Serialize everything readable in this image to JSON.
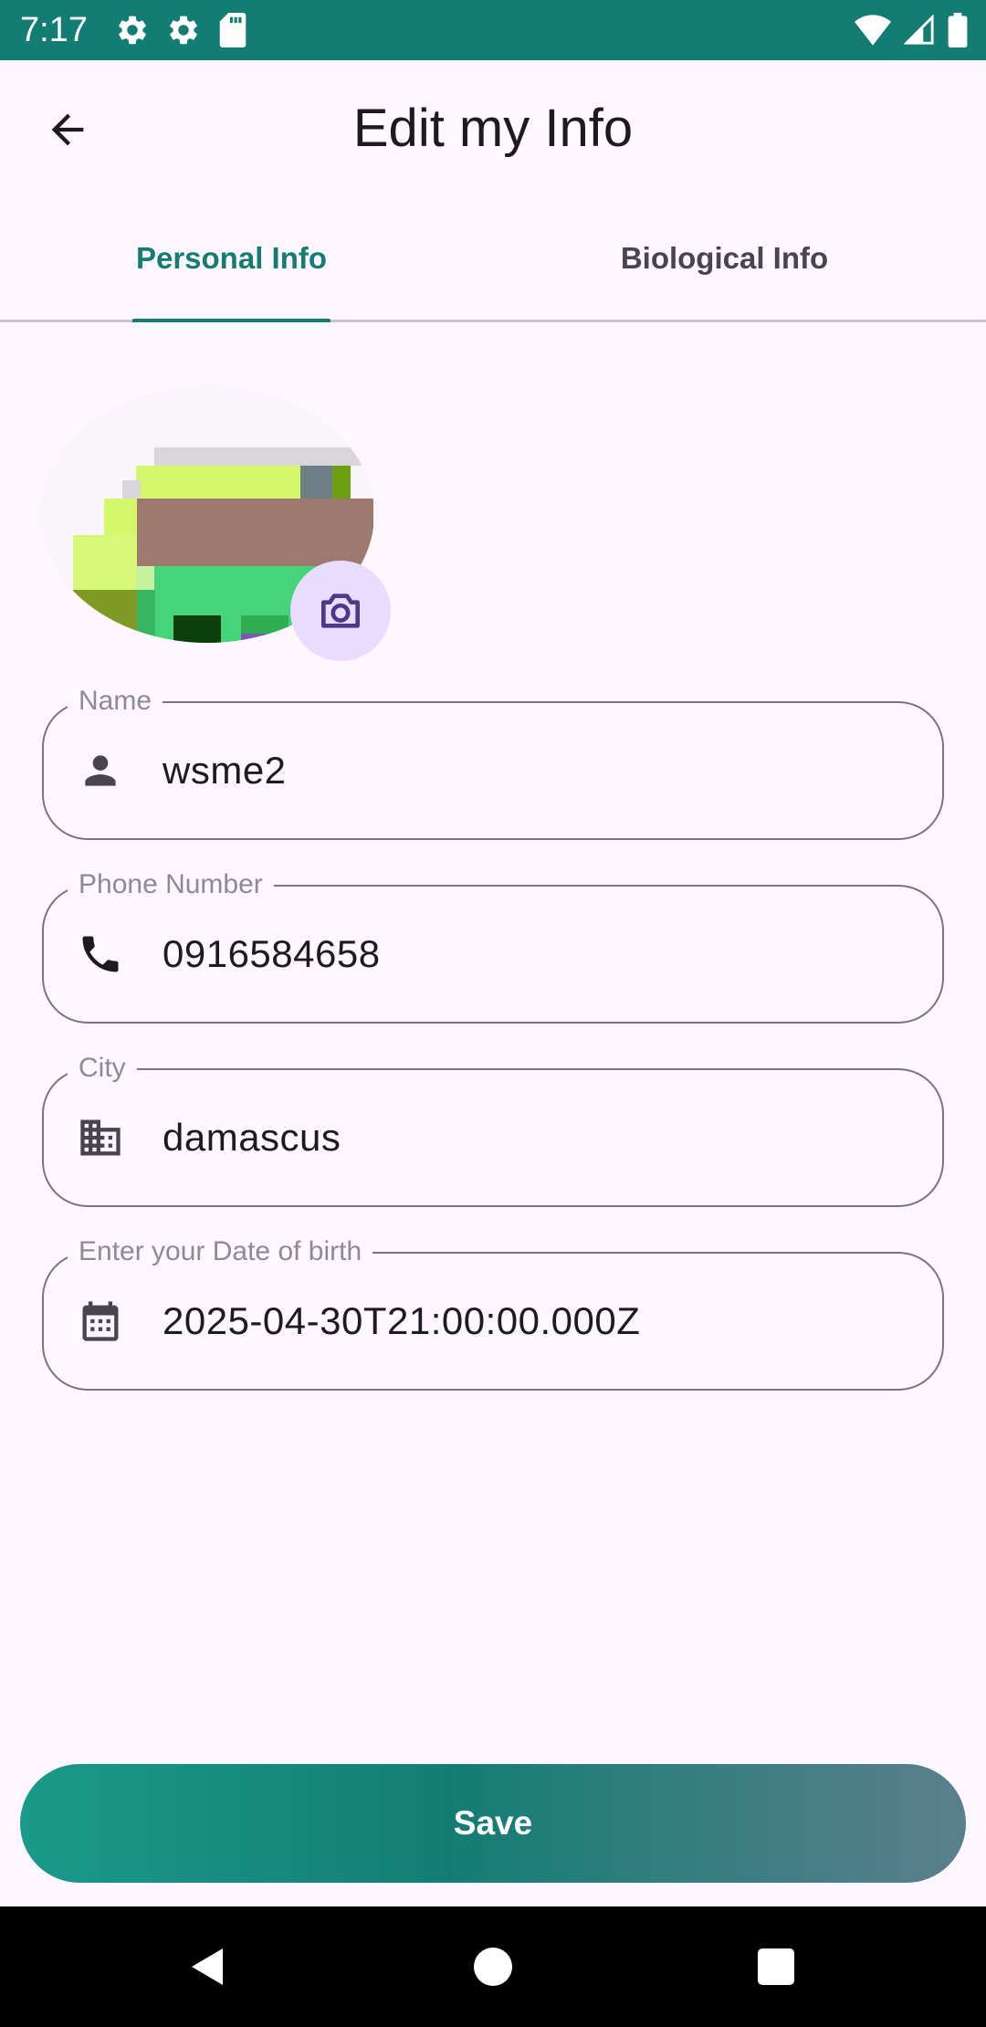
{
  "status_bar": {
    "time": "7:17",
    "left_icons": [
      "settings-icon",
      "settings-icon",
      "sd-card-icon"
    ],
    "right_icons": [
      "wifi-icon",
      "signal-icon",
      "battery-icon"
    ],
    "background": "#137D73"
  },
  "app_bar": {
    "back_icon": "arrow-back-icon",
    "title": "Edit my Info"
  },
  "tabs": [
    {
      "label": "Personal Info",
      "selected": true
    },
    {
      "label": "Biological Info",
      "selected": false
    }
  ],
  "avatar": {
    "camera_icon": "camera-icon"
  },
  "fields": {
    "name": {
      "label": "Name",
      "value": "wsme2",
      "icon": "person-icon"
    },
    "phone": {
      "label": "Phone Number",
      "value": "0916584658",
      "icon": "phone-icon"
    },
    "city": {
      "label": "City",
      "value": "damascus",
      "icon": "city-icon"
    },
    "dob": {
      "label": "Enter your Date of birth",
      "value": "2025-04-30T21:00:00.000Z",
      "icon": "calendar-icon"
    }
  },
  "save_button": {
    "label": "Save"
  },
  "colors": {
    "accent": "#137D73",
    "background": "#FEF7FF",
    "camera_button_bg": "#E9DDFF"
  },
  "nav_bar": {
    "buttons": [
      "back-triangle-icon",
      "home-circle-icon",
      "recents-square-icon"
    ]
  }
}
